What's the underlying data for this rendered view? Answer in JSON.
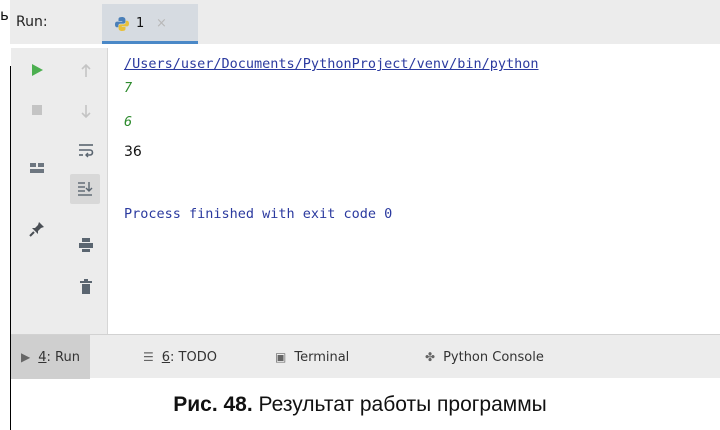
{
  "page_fragment": {
    "cut_letter": "ь"
  },
  "run_window": {
    "label": "Run:",
    "tab": {
      "label": "1",
      "close": "×"
    }
  },
  "console": {
    "path": "/Users/user/Documents/PythonProject/venv/bin/python",
    "input_1": "7",
    "input_2": "6",
    "output": "36",
    "finished": "Process finished with exit code 0"
  },
  "toolbar_left": {
    "icons": [
      "run-icon",
      "stop-icon",
      "layout-icon",
      "pin-icon"
    ]
  },
  "toolbar_right": {
    "icons": [
      "up-arrow-icon",
      "down-arrow-icon",
      "soft-wrap-icon",
      "scroll-to-end-icon",
      "print-icon",
      "trash-icon"
    ]
  },
  "bottom_bar": {
    "run": {
      "num": "4",
      "label": ": Run"
    },
    "todo": {
      "num": "6",
      "label": ": TODO"
    },
    "terminal": {
      "label": "Terminal"
    },
    "python_console": {
      "label": "Python Console"
    }
  },
  "caption": {
    "prefix": "Рис. 48.",
    "text": " Результат работы программы"
  },
  "colors": {
    "accent_blue": "#4a88c7",
    "run_green": "#4caf50",
    "path_blue": "#2b3a9f",
    "input_green": "#2e8b2e"
  }
}
